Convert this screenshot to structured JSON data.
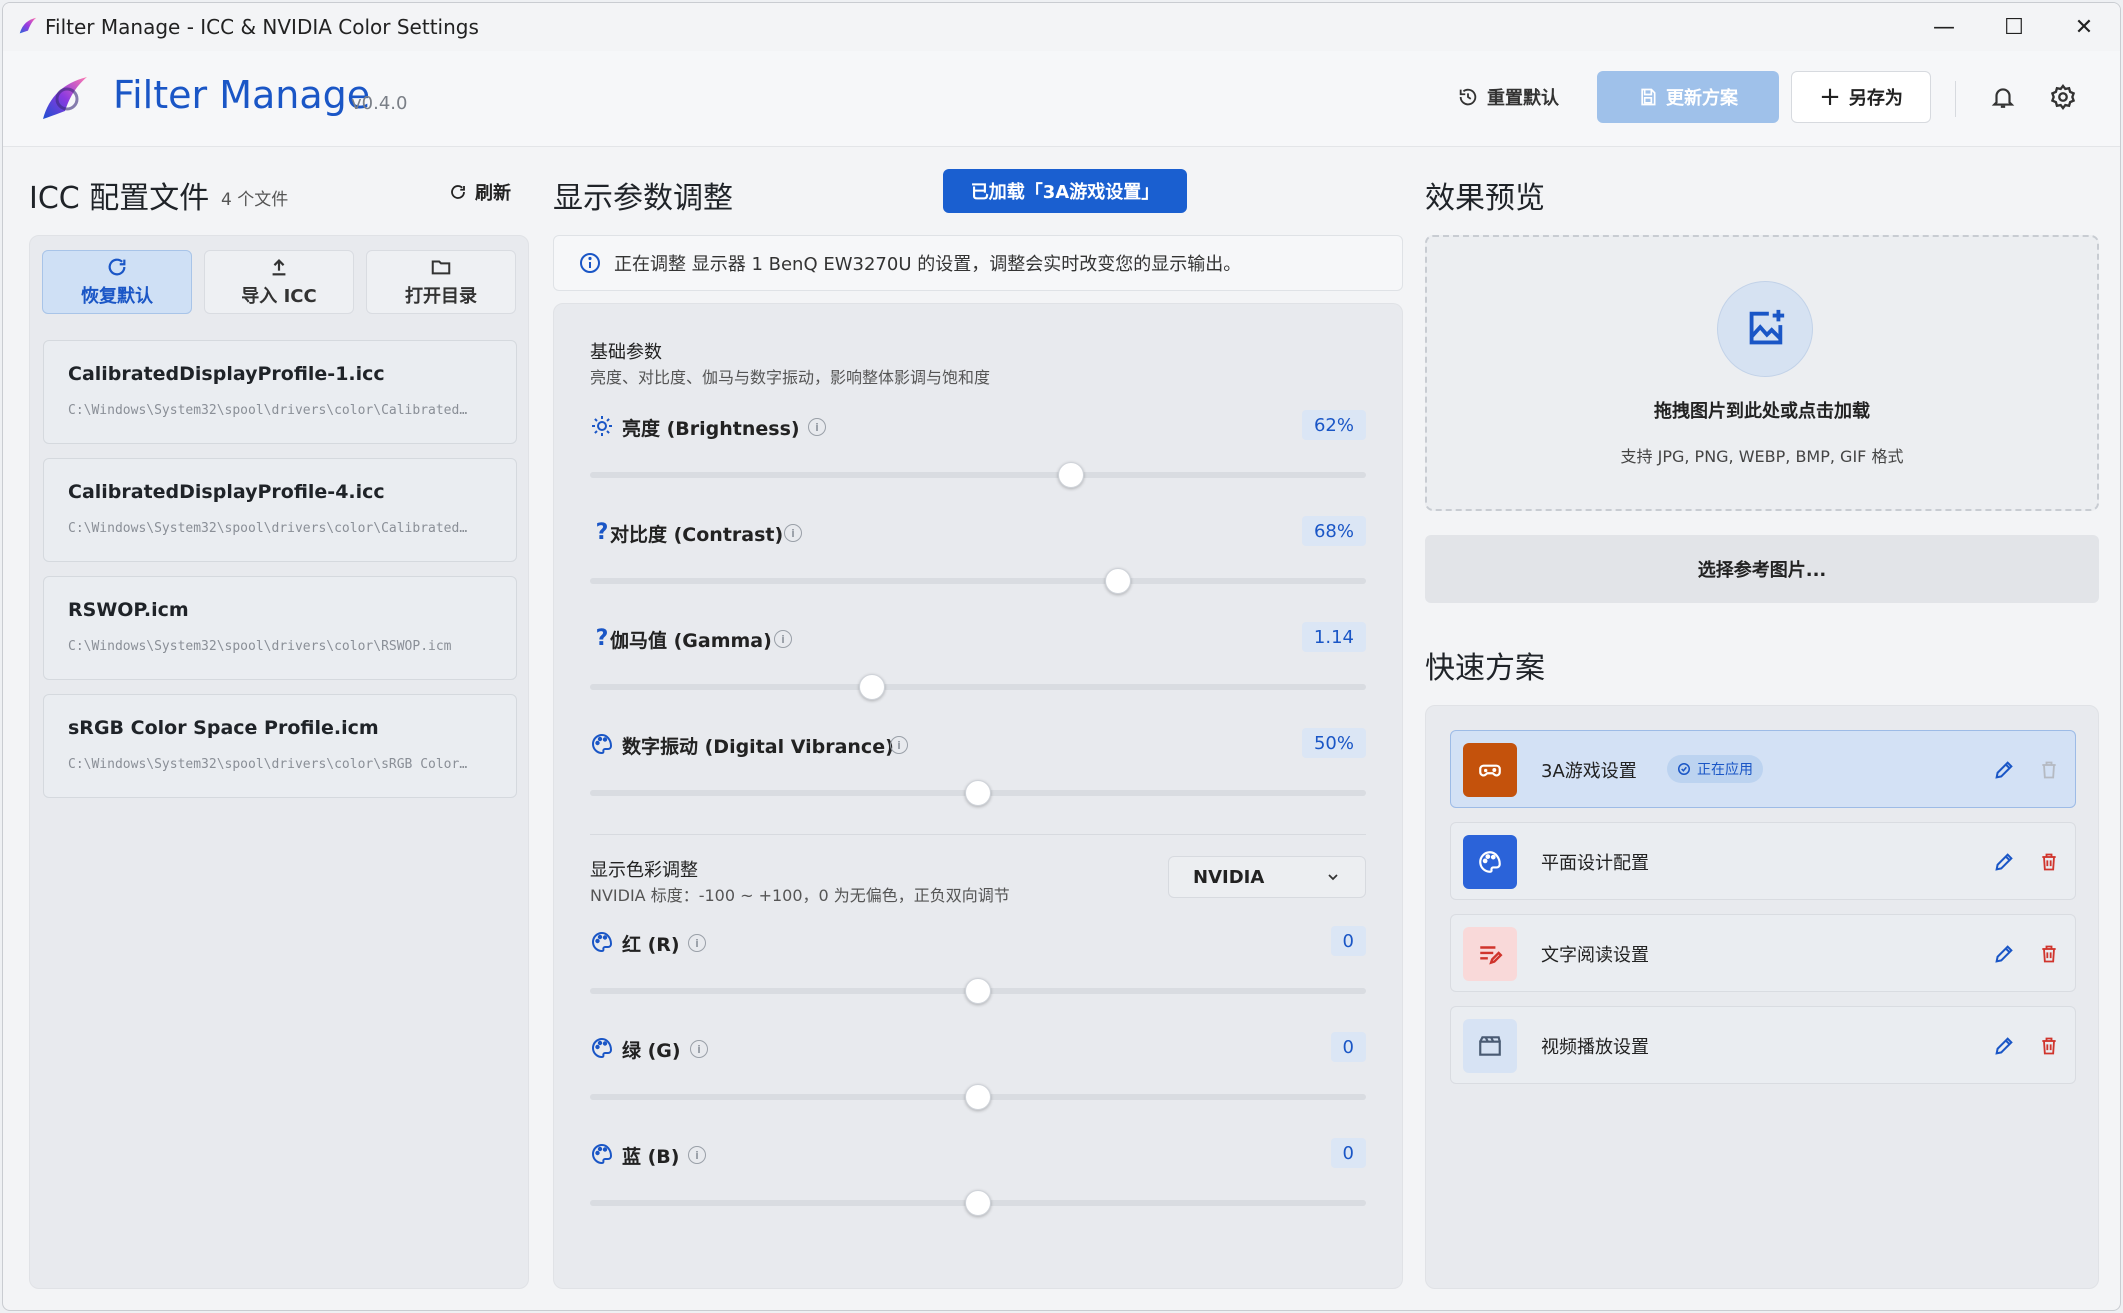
{
  "window": {
    "title": "Filter Manage - ICC & NVIDIA Color Settings",
    "controls": {
      "minimize": "—",
      "maximize": "☐",
      "close": "✕"
    }
  },
  "header": {
    "brand": "Filter Manage",
    "version": "v0.4.0",
    "reset_label": "重置默认",
    "update_label": "更新方案",
    "saveas_label": "另存为"
  },
  "icc": {
    "title": "ICC 配置文件",
    "count": "4 个文件",
    "refresh_label": "刷新",
    "tools": [
      {
        "label": "恢复默认",
        "icon": "refresh-icon",
        "active": true
      },
      {
        "label": "导入 ICC",
        "icon": "upload-icon",
        "active": false
      },
      {
        "label": "打开目录",
        "icon": "folder-icon",
        "active": false
      }
    ],
    "profiles": [
      {
        "name": "CalibratedDisplayProfile-1.icc",
        "path": "C:\\Windows\\System32\\spool\\drivers\\color\\Calibrated…"
      },
      {
        "name": "CalibratedDisplayProfile-4.icc",
        "path": "C:\\Windows\\System32\\spool\\drivers\\color\\Calibrated…"
      },
      {
        "name": "RSWOP.icm",
        "path": "C:\\Windows\\System32\\spool\\drivers\\color\\RSWOP.icm"
      },
      {
        "name": "sRGB Color Space Profile.icm",
        "path": "C:\\Windows\\System32\\spool\\drivers\\color\\sRGB Color…"
      }
    ]
  },
  "display": {
    "title": "显示参数调整",
    "loaded_badge": "已加载「3A游戏设置」",
    "info_text": "正在调整 显示器 1 BenQ EW3270U 的设置，调整会实时改变您的显示输出。",
    "basic": {
      "title": "基础参数",
      "subtitle": "亮度、对比度、伽马与数字振动，影响整体影调与饱和度",
      "sliders": [
        {
          "label": "亮度 (Brightness)",
          "icon": "sun-icon",
          "value_text": "62%",
          "position": 0.62
        },
        {
          "label": "对比度 (Contrast)",
          "icon": "question-icon",
          "value_text": "68%",
          "position": 0.68
        },
        {
          "label": "伽马值 (Gamma)",
          "icon": "question-icon",
          "value_text": "1.14",
          "position": 0.364
        },
        {
          "label": "数字振动 (Digital Vibrance)",
          "icon": "palette-icon",
          "value_text": "50%",
          "position": 0.5
        }
      ]
    },
    "color": {
      "title": "显示色彩调整",
      "subtitle": "NVIDIA 标度：-100 ~ +100，0 为无偏色，正负双向调节",
      "select_value": "NVIDIA",
      "sliders": [
        {
          "label": "红 (R)",
          "icon": "palette-icon",
          "value_text": "0",
          "position": 0.5
        },
        {
          "label": "绿 (G)",
          "icon": "palette-icon",
          "value_text": "0",
          "position": 0.5
        },
        {
          "label": "蓝 (B)",
          "icon": "palette-icon",
          "value_text": "0",
          "position": 0.5
        }
      ]
    }
  },
  "preview": {
    "title": "效果预览",
    "drop_title": "拖拽图片到此处或点击加载",
    "drop_sub": "支持 JPG, PNG, WEBP, BMP, GIF 格式",
    "choose_label": "选择参考图片..."
  },
  "quick": {
    "title": "快速方案",
    "presets": [
      {
        "name": "3A游戏设置",
        "icon": "gamepad-icon",
        "status": "正在应用",
        "active": true,
        "icon_bg": "#c4520c",
        "icon_fg": "#ffffff"
      },
      {
        "name": "平面设计配置",
        "icon": "palette-icon",
        "status": "",
        "active": false,
        "icon_bg": "#2b63d9",
        "icon_fg": "#ffffff"
      },
      {
        "name": "文字阅读设置",
        "icon": "text-edit-icon",
        "status": "",
        "active": false,
        "icon_bg": "#f9d9d9",
        "icon_fg": "#d0342c"
      },
      {
        "name": "视频播放设置",
        "icon": "clapperboard-icon",
        "status": "",
        "active": false,
        "icon_bg": "#d7e3f4",
        "icon_fg": "#4a5b73"
      }
    ]
  },
  "colors": {
    "accent": "#1a56c6",
    "danger": "#d0342c"
  }
}
